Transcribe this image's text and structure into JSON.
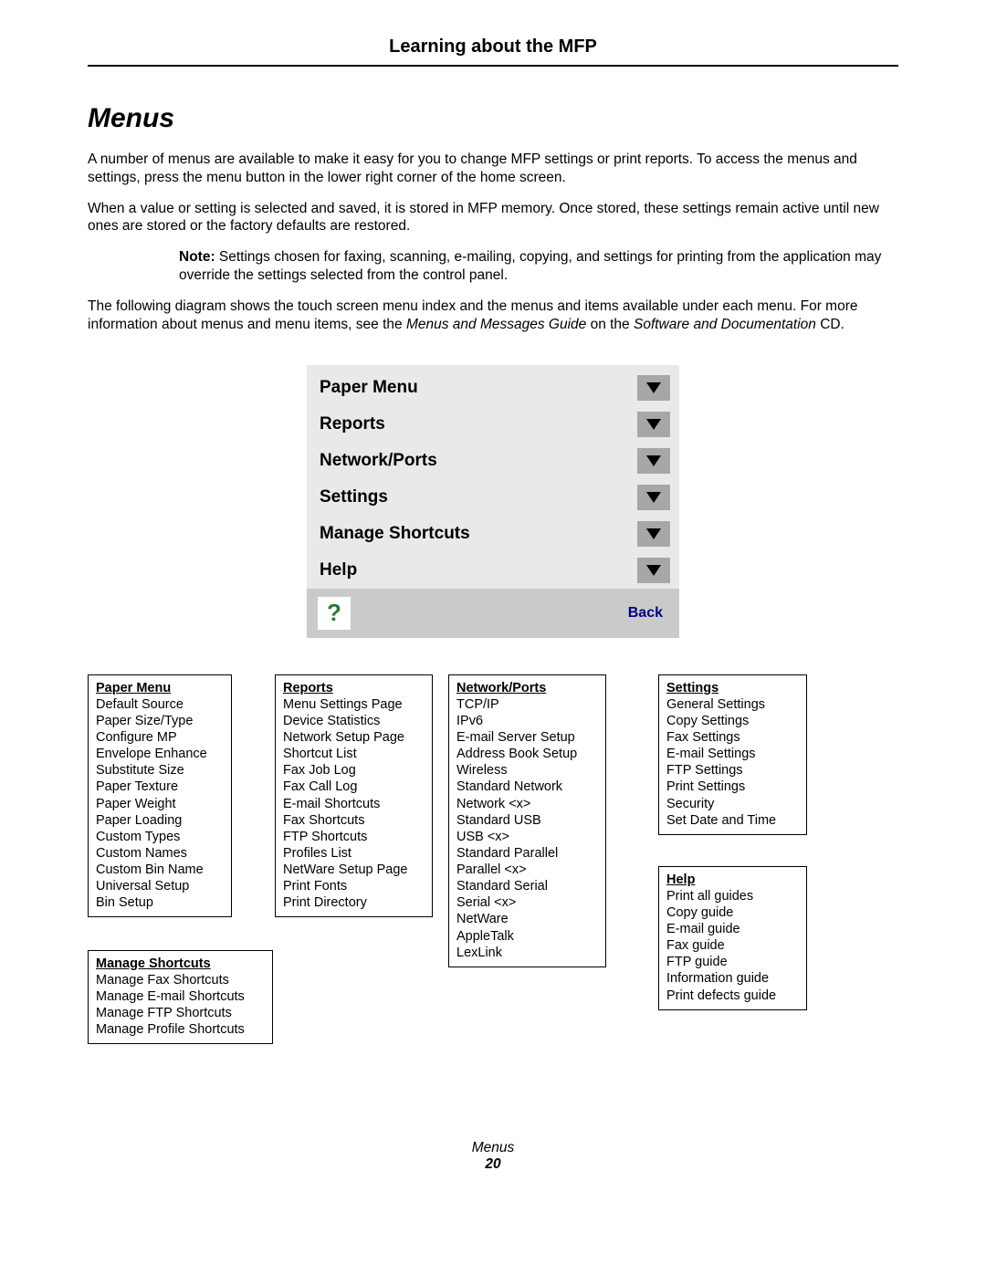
{
  "header": {
    "chapter": "Learning about the MFP"
  },
  "section": {
    "title": "Menus"
  },
  "paragraphs": {
    "p1": "A number of menus are available to make it easy for you to change MFP settings or print reports. To access the menus and settings, press the menu button in the lower right corner of the home screen.",
    "p2": "When a value or setting is selected and saved, it is stored in MFP memory. Once stored, these settings remain active until new ones are stored or the factory defaults are restored.",
    "note_label": "Note:",
    "note_body": "Settings chosen for faxing, scanning, e-mailing, copying, and settings for printing from the application may override the settings selected from the control panel.",
    "p3a": "The following diagram shows the touch screen menu index and the menus and items available under each menu. For more information about menus and menu items, see the ",
    "p3_i1": "Menus and Messages Guide",
    "p3b": " on the ",
    "p3_i2": "Software and Documentation",
    "p3c": " CD."
  },
  "touchscreen": {
    "items": [
      "Paper Menu",
      "Reports",
      "Network/Ports",
      "Settings",
      "Manage Shortcuts",
      "Help"
    ],
    "help_glyph": "?",
    "back": "Back"
  },
  "boxes": {
    "paper": {
      "title": "Paper Menu",
      "items": [
        "Default Source",
        "Paper Size/Type",
        "Configure MP",
        "Envelope Enhance",
        "Substitute Size",
        "Paper Texture",
        "Paper Weight",
        "Paper Loading",
        "Custom Types",
        "Custom Names",
        "Custom Bin Name",
        "Universal Setup",
        "Bin Setup"
      ]
    },
    "reports": {
      "title": "Reports",
      "items": [
        "Menu Settings Page",
        "Device Statistics",
        "Network Setup Page",
        "Shortcut List",
        "Fax Job Log",
        "Fax Call Log",
        "E-mail Shortcuts",
        "Fax Shortcuts",
        "FTP Shortcuts",
        "Profiles List",
        "NetWare Setup Page",
        "Print Fonts",
        "Print Directory"
      ]
    },
    "network": {
      "title": "Network/Ports",
      "items": [
        "TCP/IP",
        "IPv6",
        "E-mail Server Setup",
        "Address Book Setup",
        "Wireless",
        "Standard Network",
        "Network <x>",
        "Standard USB",
        "USB <x>",
        "Standard Parallel",
        "Parallel <x>",
        "Standard Serial",
        "Serial <x>",
        "NetWare",
        "AppleTalk",
        "LexLink"
      ]
    },
    "settings": {
      "title": "Settings",
      "items": [
        "General Settings",
        "Copy Settings",
        "Fax Settings",
        "E-mail Settings",
        "FTP Settings",
        "Print Settings",
        "Security",
        "Set Date and Time"
      ]
    },
    "help": {
      "title": "Help",
      "items": [
        "Print all guides",
        "Copy guide",
        "E-mail guide",
        "Fax guide",
        "FTP guide",
        "Information guide",
        "Print defects guide"
      ]
    },
    "manage": {
      "title": "Manage Shortcuts",
      "items": [
        "Manage Fax Shortcuts",
        "Manage E-mail Shortcuts",
        "Manage FTP Shortcuts",
        "Manage Profile Shortcuts"
      ]
    }
  },
  "footer": {
    "title": "Menus",
    "page": "20"
  }
}
